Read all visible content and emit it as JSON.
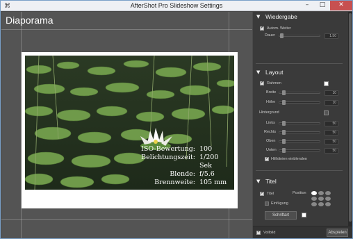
{
  "window": {
    "title": "AfterShot Pro Slideshow Settings"
  },
  "preview": {
    "heading": "Diaporama",
    "exif": [
      {
        "key": "ISO-Bewertung:",
        "value": "100"
      },
      {
        "key": "Belichtungszeit:",
        "value": "1/200 Sek"
      },
      {
        "key": "Blende:",
        "value": "f/5.6"
      },
      {
        "key": "Brennweite:",
        "value": "105 mm"
      }
    ]
  },
  "wiedergabe": {
    "title": "Wiedergabe",
    "auto_label": "Autom. Weiter",
    "dauer_label": "Dauer",
    "dauer_value": "1.50"
  },
  "layout": {
    "title": "Layout",
    "rahmen_label": "Rahmen",
    "breite_label": "Breite",
    "breite_value": "10",
    "hoehe_label": "Höhe",
    "hoehe_value": "10",
    "hintergrund_label": "Hintergrund",
    "links_label": "Links",
    "links_value": "50",
    "rechts_label": "Rechts",
    "rechts_value": "50",
    "oben_label": "Oben",
    "oben_value": "50",
    "unten_label": "Unten",
    "unten_value": "50",
    "hilfslinien_label": "Hilfslinien einblenden"
  },
  "titel": {
    "title": "Titel",
    "titel_label": "Titel",
    "position_label": "Position",
    "einfuegung_label": "Einfügung",
    "schriftart_label": "Schriftart"
  },
  "bottom": {
    "vollbild_label": "Vollbild",
    "abspielen_label": "Abspielen"
  }
}
